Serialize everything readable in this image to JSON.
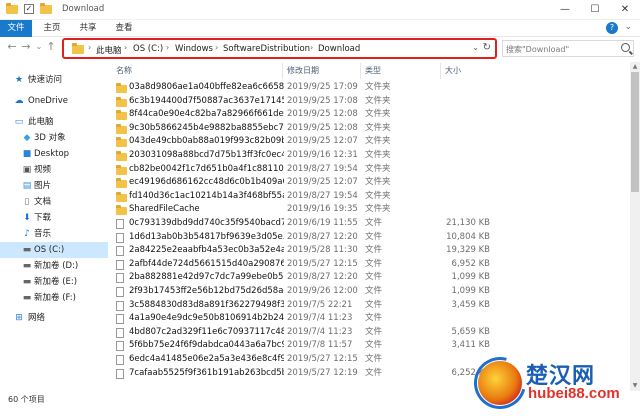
{
  "window": {
    "title": "Download",
    "minimize": "—",
    "maximize": "☐",
    "close": "✕"
  },
  "ribbon": {
    "tabs": [
      "文件",
      "主页",
      "共享",
      "查看"
    ],
    "expand": "⌄",
    "help": "?"
  },
  "navigation": {
    "back": "←",
    "forward": "→",
    "recent": "⌄",
    "up": "↑"
  },
  "address": {
    "breadcrumbs": [
      "此电脑",
      "OS (C:)",
      "Windows",
      "SoftwareDistribution",
      "Download"
    ],
    "separator": "›",
    "dropdown": "⌄",
    "refresh": "↻"
  },
  "search": {
    "placeholder": "搜索\"Download\""
  },
  "sidebar": {
    "items": [
      {
        "label": "快速访问",
        "icon": "star-icon"
      },
      {
        "label": "OneDrive",
        "icon": "cloud-icon"
      },
      {
        "label": "此电脑",
        "icon": "computer-icon"
      },
      {
        "label": "3D 对象",
        "icon": "cube-icon"
      },
      {
        "label": "Desktop",
        "icon": "desktop-icon"
      },
      {
        "label": "视频",
        "icon": "video-icon"
      },
      {
        "label": "图片",
        "icon": "picture-icon"
      },
      {
        "label": "文档",
        "icon": "document-icon"
      },
      {
        "label": "下载",
        "icon": "download-icon"
      },
      {
        "label": "音乐",
        "icon": "music-icon"
      },
      {
        "label": "OS (C:)",
        "icon": "drive-icon",
        "selected": true
      },
      {
        "label": "新加卷 (D:)",
        "icon": "drive-icon"
      },
      {
        "label": "新加卷 (E:)",
        "icon": "drive-icon"
      },
      {
        "label": "新加卷 (F:)",
        "icon": "drive-icon"
      },
      {
        "label": "网络",
        "icon": "network-icon"
      }
    ]
  },
  "columns": {
    "name": "名称",
    "date": "修改日期",
    "type": "类型",
    "size": "大小"
  },
  "files": [
    {
      "name": "03a8d9806ae1a040bffe82ea6c6658fc",
      "date": "2019/9/25 17:09",
      "type": "文件夹",
      "size": "",
      "kind": "folder"
    },
    {
      "name": "6c3b194400d7f50887ac3637e17145...",
      "date": "2019/9/25 17:08",
      "type": "文件夹",
      "size": "",
      "kind": "folder"
    },
    {
      "name": "8f44ca0e90e4c82ba7a82966f661def5",
      "date": "2019/9/25 12:08",
      "type": "文件夹",
      "size": "",
      "kind": "folder"
    },
    {
      "name": "9c30b5866245b4e9882ba8855ebc7a...",
      "date": "2019/9/25 12:08",
      "type": "文件夹",
      "size": "",
      "kind": "folder"
    },
    {
      "name": "043de49cbb0ab88a019f993c82b09b...",
      "date": "2019/9/25 12:07",
      "type": "文件夹",
      "size": "",
      "kind": "folder"
    },
    {
      "name": "203031098a88bcd7d75b13ff3fc0ec4a",
      "date": "2019/9/16 12:31",
      "type": "文件夹",
      "size": "",
      "kind": "folder"
    },
    {
      "name": "cb82be0042f1c7d651b0a4f1c8811001",
      "date": "2019/8/27 19:54",
      "type": "文件夹",
      "size": "",
      "kind": "folder"
    },
    {
      "name": "ec49196d686162cc48d6c0b1b409a6...",
      "date": "2019/9/25 12:07",
      "type": "文件夹",
      "size": "",
      "kind": "folder"
    },
    {
      "name": "fd140d36c1ac10214b14a3f468bf55a0",
      "date": "2019/8/27 19:54",
      "type": "文件夹",
      "size": "",
      "kind": "folder"
    },
    {
      "name": "SharedFileCache",
      "date": "2019/9/16 19:35",
      "type": "文件夹",
      "size": "",
      "kind": "folder"
    },
    {
      "name": "0c793139dbd9dd740c35f9540bacd7...",
      "date": "2019/6/19 11:55",
      "type": "文件",
      "size": "21,130 KB",
      "kind": "file"
    },
    {
      "name": "1d6d13ab0b3b54817bf9639e3d05e...",
      "date": "2019/8/27 12:20",
      "type": "文件",
      "size": "10,804 KB",
      "kind": "file"
    },
    {
      "name": "2a84225e2eaabfb4a53ec0b3a52e4af...",
      "date": "2019/5/28 11:30",
      "type": "文件",
      "size": "19,329 KB",
      "kind": "file"
    },
    {
      "name": "2afbf44de724d5661515d40a290876f...",
      "date": "2019/5/27 12:15",
      "type": "文件",
      "size": "6,952 KB",
      "kind": "file"
    },
    {
      "name": "2ba882881e42d97c7dc7a99ebe0b5...",
      "date": "2019/8/27 12:20",
      "type": "文件",
      "size": "1,099 KB",
      "kind": "file"
    },
    {
      "name": "2f93b17453ff2e56b12bd75d26d58ad...",
      "date": "2019/9/26 12:00",
      "type": "文件",
      "size": "1,099 KB",
      "kind": "file"
    },
    {
      "name": "3c5884830d83d8a891f362279498f30...",
      "date": "2019/7/5 22:21",
      "type": "文件",
      "size": "3,459 KB",
      "kind": "file"
    },
    {
      "name": "4a1a90e4e9dc9e50b8106914b2b24...",
      "date": "2019/7/4 11:23",
      "type": "文件",
      "size": "",
      "kind": "file"
    },
    {
      "name": "4bd807c2ad329f11e6c70937117c48...",
      "date": "2019/7/4 11:23",
      "type": "文件",
      "size": "5,659 KB",
      "kind": "file"
    },
    {
      "name": "5f6bb75e24f6f9dabdca0443a6a7bc9...",
      "date": "2019/7/8 11:57",
      "type": "文件",
      "size": "3,411 KB",
      "kind": "file"
    },
    {
      "name": "6edc4a41485e06e2a5a3e436e8c4f9...",
      "date": "2019/5/27 12:15",
      "type": "文件",
      "size": "",
      "kind": "file"
    },
    {
      "name": "7cafaab5525f9f361b191ab263bcd5b...",
      "date": "2019/5/27 12:19",
      "type": "文件",
      "size": "6,252 KB",
      "kind": "file"
    }
  ],
  "status": {
    "count": "60 个项目"
  },
  "watermark": {
    "title": "楚汉网",
    "url": "hubei88.com"
  }
}
